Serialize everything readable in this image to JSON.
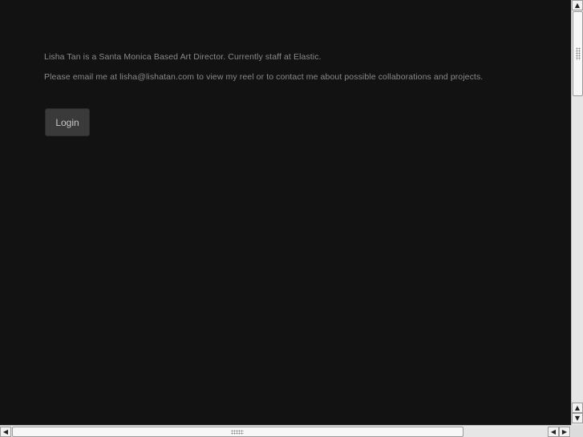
{
  "page": {
    "intro_text": "Lisha Tan is a Santa Monica Based Art Director. Currently staff at Elastic.",
    "contact_text": "Please email me at lisha@lishatan.com to view my reel or to contact me about possible collaborations and projects.",
    "login_label": "Login"
  },
  "scrollbars": {
    "up_arrow": "▲",
    "down_arrow": "▼",
    "left_arrow": "◀",
    "right_arrow": "▶"
  },
  "colors": {
    "background": "#121212",
    "text": "#8a8a8a",
    "button_bg": "#3a3a3a",
    "button_text": "#c8c8c8"
  }
}
